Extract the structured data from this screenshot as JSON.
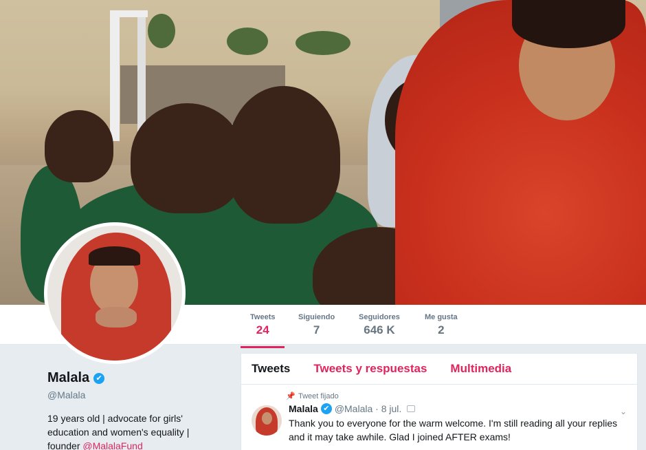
{
  "stats": [
    {
      "label": "Tweets",
      "value": "24"
    },
    {
      "label": "Siguiendo",
      "value": "7"
    },
    {
      "label": "Seguidores",
      "value": "646 K"
    },
    {
      "label": "Me gusta",
      "value": "2"
    }
  ],
  "profile": {
    "name": "Malala",
    "verified_badge": "✔",
    "handle": "@Malala",
    "bio_text": "19 years old | advocate for girls' education and women's equality | founder ",
    "bio_link": "@MalalaFund"
  },
  "tabs": [
    "Tweets",
    "Tweets y respuestas",
    "Multimedia"
  ],
  "tweet": {
    "pinned_label": "Tweet fijado",
    "pin_icon": "📌",
    "name": "Malala",
    "verified_badge": "✔",
    "handle_date": "@Malala · 8 jul.",
    "text": "Thank you to everyone for the warm welcome. I'm still reading all your replies and it may take awhile. Glad I joined AFTER exams!",
    "caret": "⌄"
  },
  "colors": {
    "accent": "#e0245e",
    "verified": "#1da1f2",
    "background": "#e6ecf0"
  }
}
